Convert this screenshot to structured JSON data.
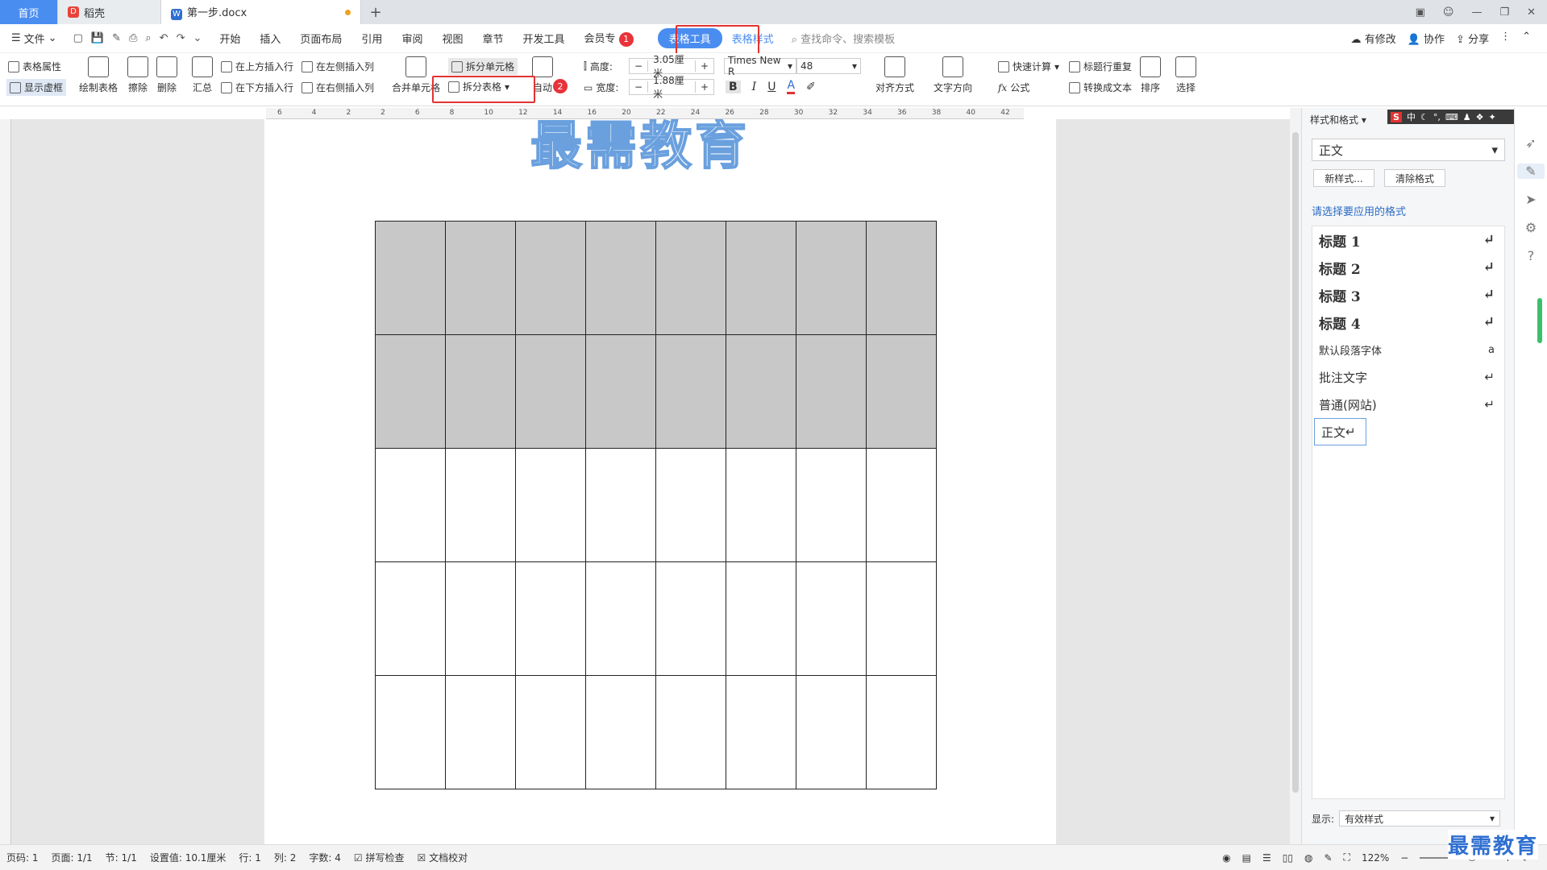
{
  "tabs": {
    "home": "首页",
    "daoke": "稻壳",
    "doc": "第一步.docx",
    "plus": "+"
  },
  "menu": {
    "file": "文件",
    "items": [
      "开始",
      "插入",
      "页面布局",
      "引用",
      "审阅",
      "视图",
      "章节",
      "开发工具",
      "会员专"
    ],
    "table_tools": "表格工具",
    "table_style": "表格样式",
    "search": "查找命令、搜索模板",
    "right": [
      "有修改",
      "协作",
      "分享"
    ]
  },
  "badges": [
    "1",
    "2"
  ],
  "ribbon": {
    "table_props": "表格属性",
    "show_grid": "显示虚框",
    "draw_table": "绘制表格",
    "erase": "擦除",
    "delete": "删除",
    "summary": "汇总",
    "insert_above": "在上方插入行",
    "insert_below": "在下方插入行",
    "insert_left": "在左侧插入列",
    "insert_right": "在右侧插入列",
    "merge": "合并单元格",
    "split_cell": "拆分单元格",
    "split_table": "拆分表格",
    "auto": "自动",
    "height_label": "高度:",
    "height_value": "3.05厘米",
    "width_label": "宽度:",
    "width_value": "1.88厘米",
    "font_name": "Times New R",
    "font_size": "48",
    "align": "对齐方式",
    "text_dir": "文字方向",
    "quick_calc": "快速计算",
    "formula": "公式",
    "repeat_header": "标题行重复",
    "to_text": "转换成文本",
    "sort": "排序",
    "select": "选择"
  },
  "ruler_marks": [
    "6",
    "4",
    "2",
    "2",
    "6",
    "8",
    "10",
    "12",
    "14",
    "16",
    "20",
    "22",
    "24",
    "26",
    "28",
    "30",
    "32",
    "34",
    "36",
    "38",
    "40",
    "42"
  ],
  "doc": {
    "watermark": "最需教育",
    "table": {
      "rows": 5,
      "cols": 8,
      "shaded_rows": 2
    }
  },
  "panel": {
    "title": "样式和格式",
    "current_style": "正文",
    "new_style": "新样式...",
    "clear_format": "清除格式",
    "hint": "请选择要应用的格式",
    "styles": [
      "标题  1",
      "标题  2",
      "标题  3",
      "标题  4",
      "默认段落字体",
      "批注文字",
      "普通(网站)",
      "正文"
    ],
    "show_label": "显示:",
    "show_value": "有效样式",
    "ime": "中"
  },
  "status": {
    "page_code": "页码: 1",
    "page": "页面: 1/1",
    "section": "节: 1/1",
    "setting": "设置值: 10.1厘米",
    "row": "行: 1",
    "col": "列: 2",
    "words": "字数: 4",
    "spell": "拼写检查",
    "proof": "文档校对",
    "zoom": "122%",
    "brand": "最需教育"
  }
}
